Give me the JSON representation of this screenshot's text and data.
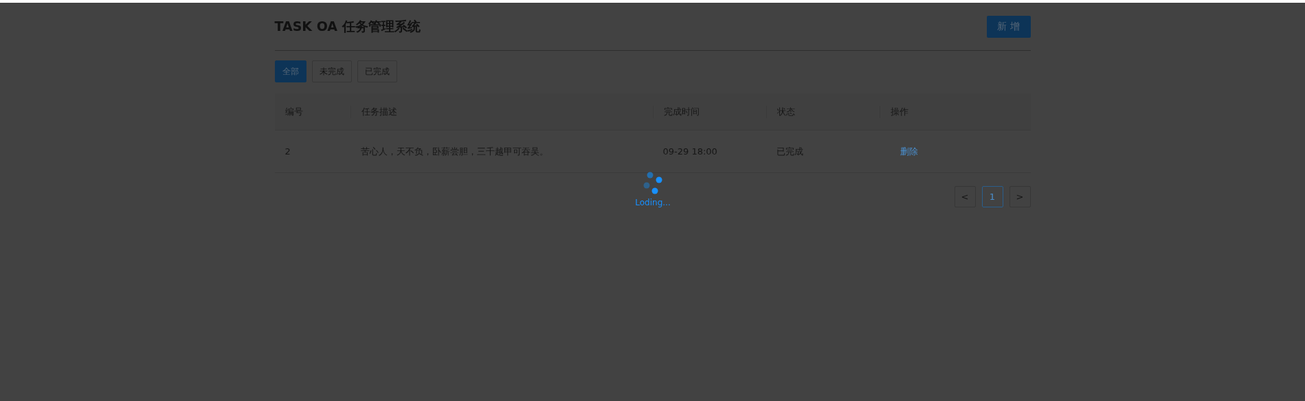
{
  "header": {
    "title": "TASK OA 任务管理系统",
    "add_button": "新 增"
  },
  "filters": [
    {
      "label": "全部",
      "selected": true
    },
    {
      "label": "未完成",
      "selected": false
    },
    {
      "label": "已完成",
      "selected": false
    }
  ],
  "table": {
    "columns": [
      "编号",
      "任务描述",
      "完成时间",
      "状态",
      "操作"
    ],
    "rows": [
      {
        "id": "2",
        "description": "苦心人，天不负，卧薪尝胆，三千越甲可吞吴。",
        "time": "09-29 18:00",
        "status": "已完成",
        "action": "删除"
      }
    ]
  },
  "pagination": {
    "prev": "<",
    "next": ">",
    "pages": [
      {
        "label": "1",
        "selected": true
      }
    ]
  },
  "loading": {
    "text": "Loding..."
  }
}
